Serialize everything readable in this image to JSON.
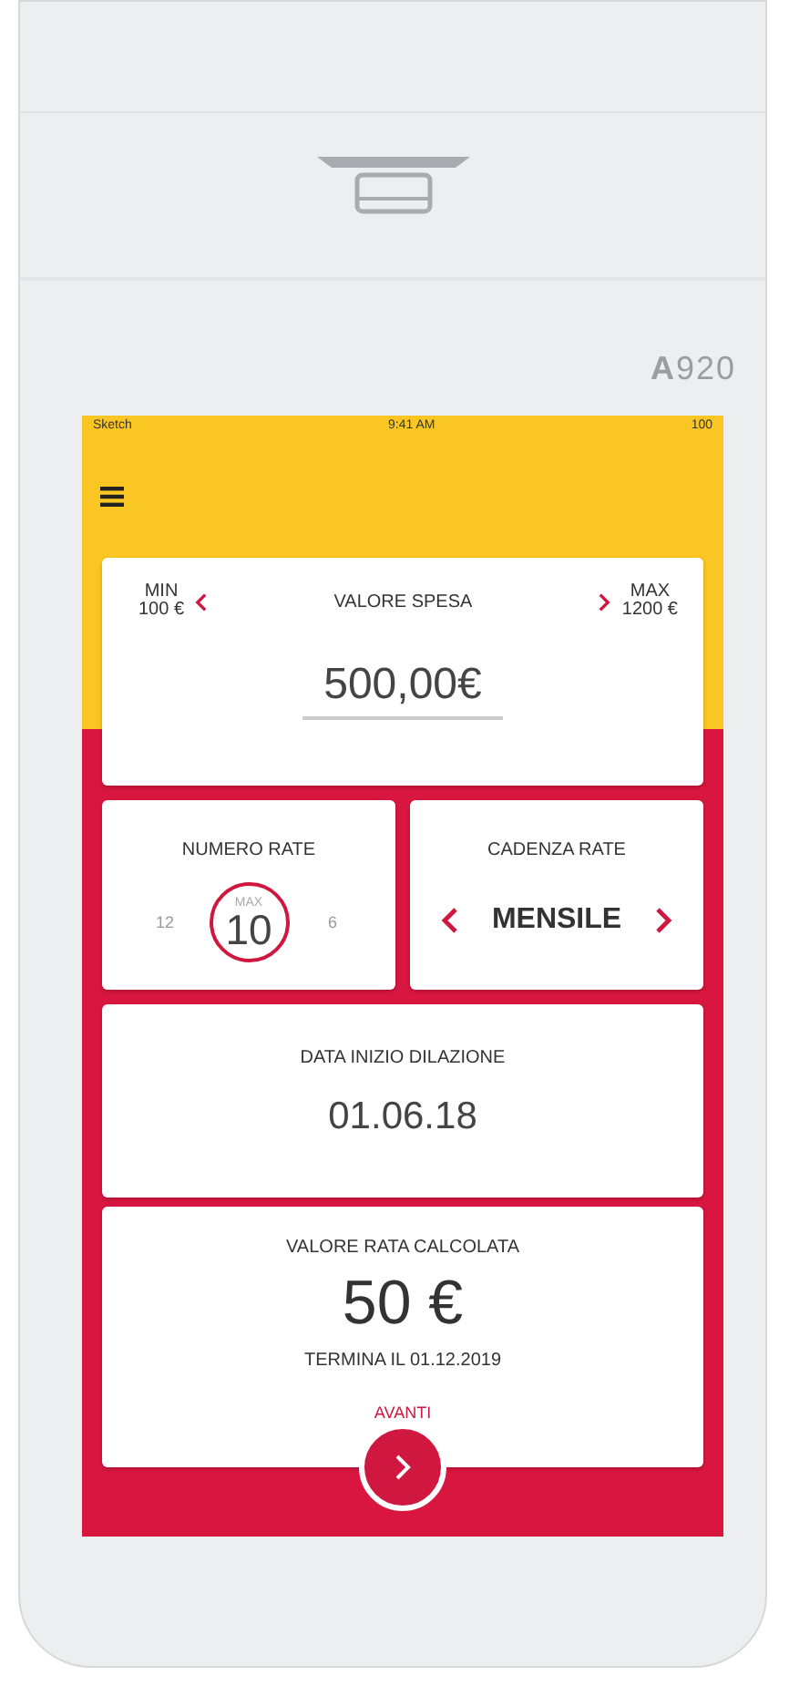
{
  "device": {
    "model": "A920"
  },
  "status_bar": {
    "carrier": "Sketch",
    "time": "9:41 AM",
    "battery": "100"
  },
  "amount_card": {
    "min_label": "MIN",
    "min_value": "100 €",
    "title": "VALORE SPESA",
    "max_label": "MAX",
    "max_value": "1200 €",
    "value": "500,00€"
  },
  "installments_card": {
    "title": "NUMERO RATE",
    "options": [
      {
        "label": "12",
        "selected": false
      },
      {
        "label": "10",
        "selected": true,
        "note": "MAX"
      },
      {
        "label": "6",
        "selected": false
      }
    ]
  },
  "frequency_card": {
    "title": "CADENZA RATE",
    "value": "MENSILE"
  },
  "start_card": {
    "title": "DATA INIZIO DILAZIONE",
    "value": "01.06.18"
  },
  "result_card": {
    "title": "VALORE RATA CALCOLATA",
    "value": "50 €",
    "end_note": "TERMINA IL 01.12.2019",
    "action": "AVANTI"
  }
}
